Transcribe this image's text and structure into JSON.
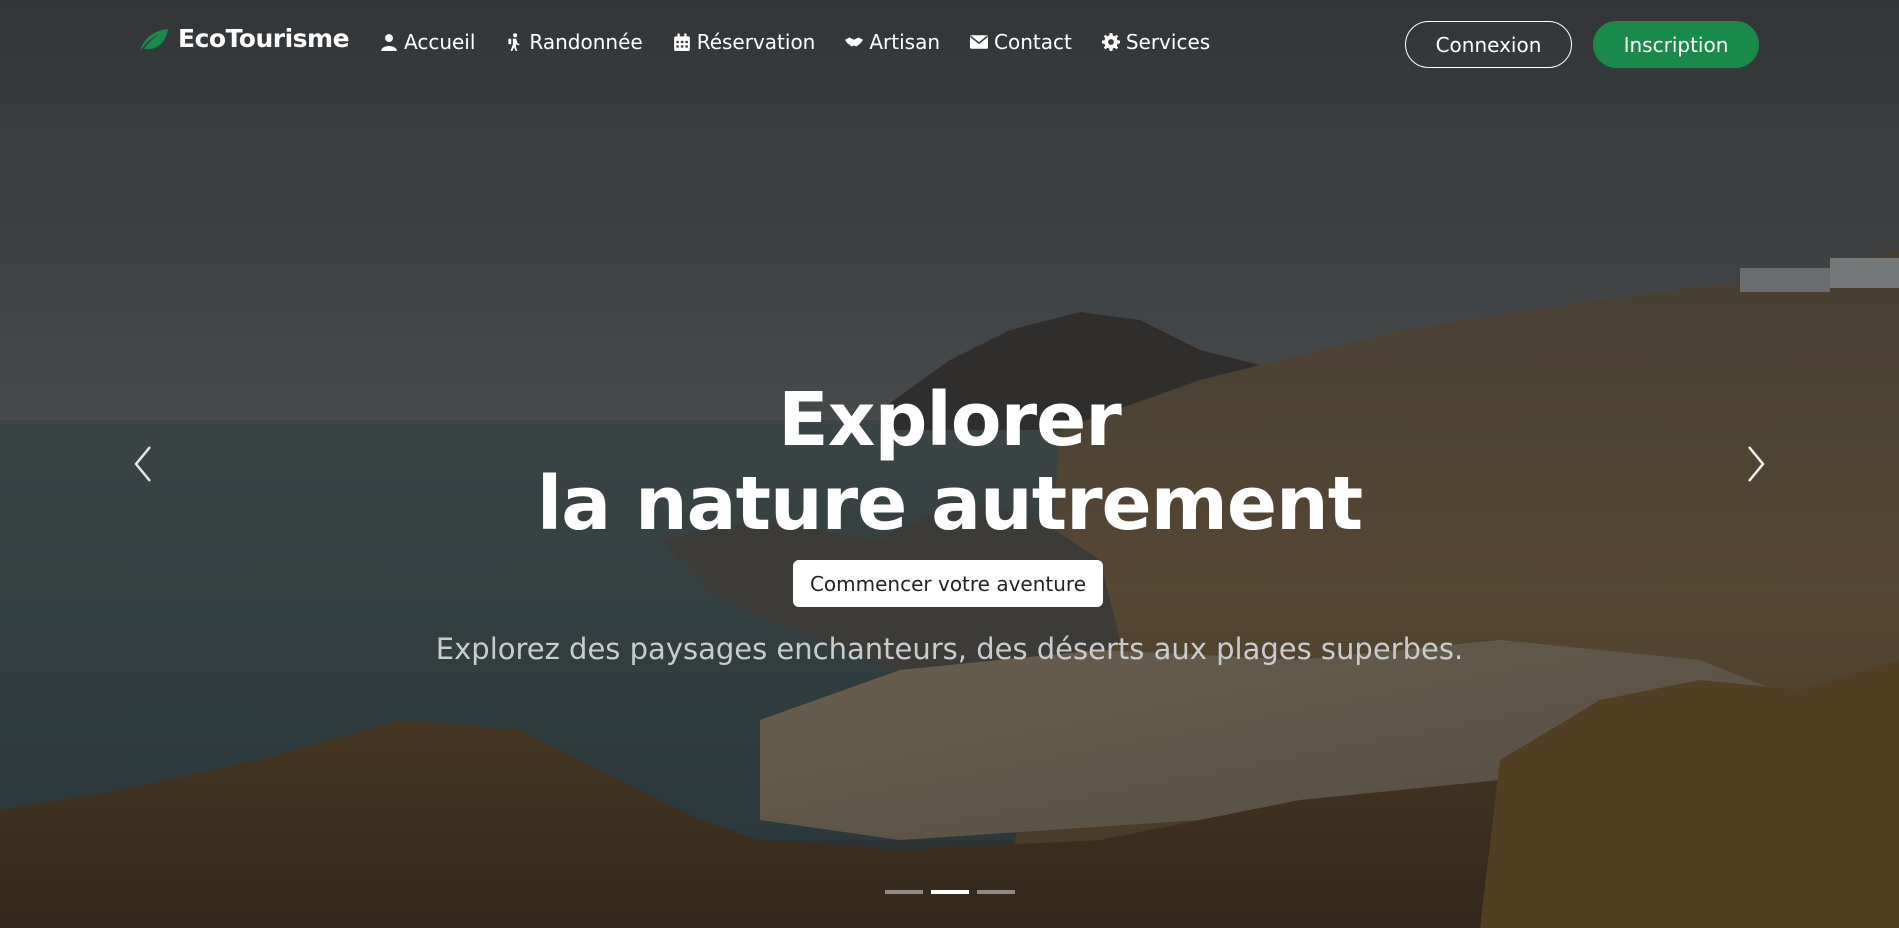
{
  "brand": {
    "name": "EcoTourisme",
    "icon": "leaf-icon"
  },
  "nav": {
    "items": [
      {
        "label": "Accueil",
        "icon": "user-icon"
      },
      {
        "label": "Randonnée",
        "icon": "hiking-icon"
      },
      {
        "label": "Réservation",
        "icon": "calendar-icon"
      },
      {
        "label": "Artisan",
        "icon": "handshake-icon"
      },
      {
        "label": "Contact",
        "icon": "envelope-icon"
      },
      {
        "label": "Services",
        "icon": "gear-icon"
      }
    ],
    "login_label": "Connexion",
    "signup_label": "Inscription"
  },
  "hero": {
    "title_line1": "Explorer",
    "title_line2": "la nature autrement",
    "cta_label": "Commencer votre aventure",
    "subtitle": "Explorez des paysages enchanteurs, des déserts aux plages superbes.",
    "active_slide": 2,
    "slide_count": 3
  },
  "colors": {
    "accent": "#1a8a4a",
    "text": "#ffffff"
  }
}
